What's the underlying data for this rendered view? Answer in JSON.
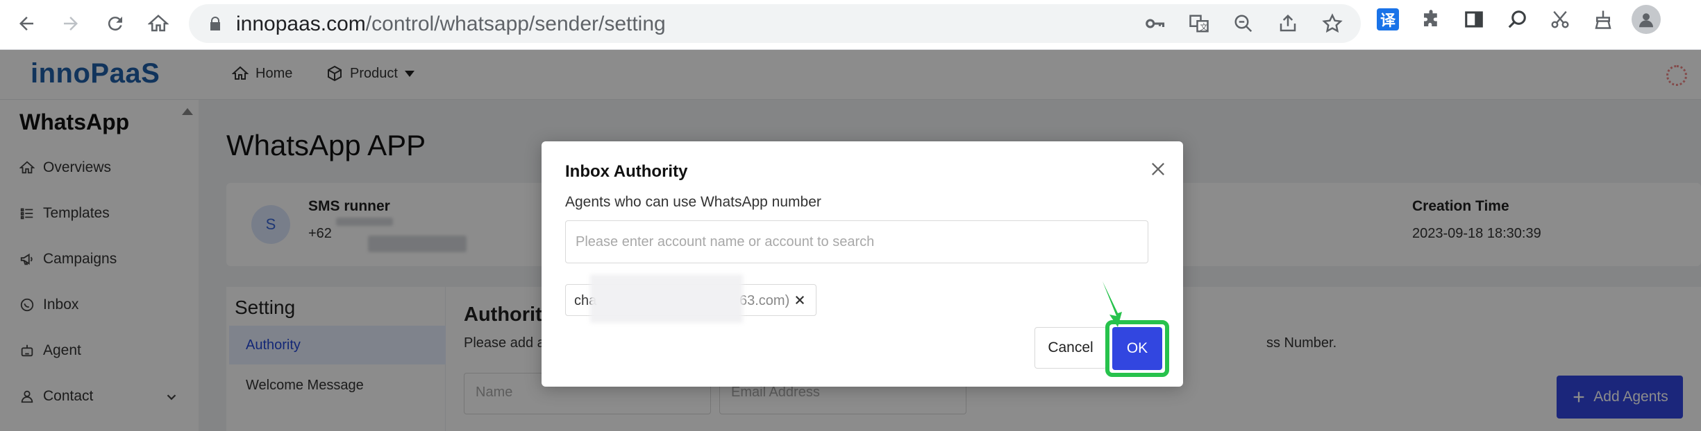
{
  "browser": {
    "url_domain": "innopaas.com",
    "url_path": "/control/whatsapp/sender/setting",
    "translate_badge": "译"
  },
  "header": {
    "logo": "innoPaaS",
    "nav_home": "Home",
    "nav_product": "Product"
  },
  "sidebar": {
    "title": "WhatsApp",
    "items": [
      {
        "label": "Overviews",
        "icon": "home-icon"
      },
      {
        "label": "Templates",
        "icon": "list-icon"
      },
      {
        "label": "Campaigns",
        "icon": "megaphone-icon"
      },
      {
        "label": "Inbox",
        "icon": "chat-icon"
      },
      {
        "label": "Agent",
        "icon": "robot-icon"
      },
      {
        "label": "Contact",
        "icon": "user-icon"
      }
    ]
  },
  "main": {
    "page_title": "WhatsApp APP",
    "sender": {
      "avatar_letter": "S",
      "name": "SMS runner",
      "phone_prefix": "+62"
    },
    "creation_time_label": "Creation Time",
    "creation_time_value": "2023-09-18 18:30:39",
    "settings": {
      "title": "Setting",
      "items": [
        "Authority",
        "Welcome Message"
      ],
      "section_title": "Authorit",
      "desc_start": "Please add a",
      "desc_end": "ss Number.",
      "name_placeholder": "Name",
      "email_placeholder": "Email Address",
      "add_agents_label": "Add Agents"
    }
  },
  "modal": {
    "title": "Inbox Authority",
    "subtitle": "Agents who can use WhatsApp number",
    "search_placeholder": "Please enter account name or account to search",
    "tag_start": "cha",
    "tag_end": "63.com)",
    "cancel_label": "Cancel",
    "ok_label": "OK"
  },
  "colors": {
    "primary": "#3246e0",
    "highlight": "#27c24c",
    "logo": "#1f5fa8"
  }
}
